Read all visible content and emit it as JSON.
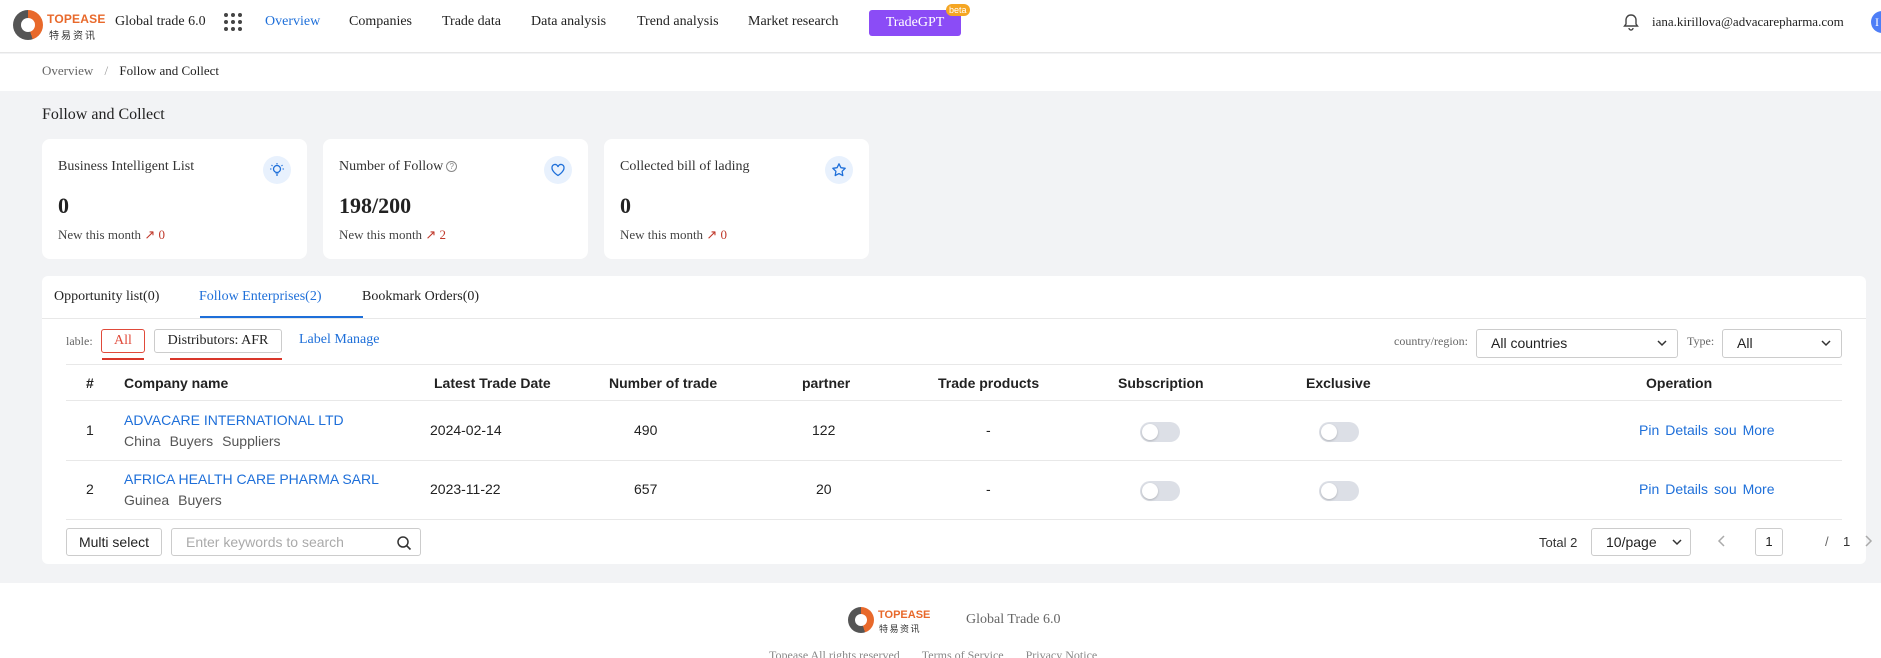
{
  "header": {
    "logo_text": "TOPEASE",
    "logo_subtext": "特易资讯",
    "product": "Global trade 6.0",
    "nav": [
      {
        "label": "Overview",
        "active": true
      },
      {
        "label": "Companies"
      },
      {
        "label": "Trade data"
      },
      {
        "label": "Data analysis"
      },
      {
        "label": "Trend analysis"
      },
      {
        "label": "Market research"
      }
    ],
    "tradegpt": "TradeGPT",
    "beta": "beta",
    "user_email": "iana.kirillova@advacarepharma.com",
    "avatar_initial": "I"
  },
  "breadcrumb": {
    "root": "Overview",
    "separator": "/",
    "current": "Follow and Collect"
  },
  "page_title": "Follow and Collect",
  "cards": [
    {
      "title": "Business Intelligent List",
      "value": "0",
      "new_label": "New this month",
      "new_value": "0",
      "icon": "bulb-icon"
    },
    {
      "title": "Number of Follow",
      "value": "198/200",
      "new_label": "New this month",
      "new_value": "2",
      "icon": "heart-icon",
      "help": "?"
    },
    {
      "title": "Collected bill of lading",
      "value": "0",
      "new_label": "New this month",
      "new_value": "0",
      "icon": "star-icon"
    }
  ],
  "tabs": [
    {
      "label": "Opportunity list(0)"
    },
    {
      "label": "Follow Enterprises(2)",
      "active": true
    },
    {
      "label": "Bookmark Orders(0)"
    }
  ],
  "filters": {
    "label_prefix": "lable:",
    "all_chip": "All",
    "label_chip": "Distributors: AFR",
    "label_manage": "Label Manage",
    "country_label": "country/region:",
    "country_value": "All countries",
    "type_label": "Type:",
    "type_value": "All"
  },
  "table": {
    "headers": [
      "#",
      "Company name",
      "Latest Trade Date",
      "Number of trade",
      "partner",
      "Trade products",
      "Subscription",
      "Exclusive",
      "Operation"
    ],
    "rows": [
      {
        "index": "1",
        "name": "ADVACARE INTERNATIONAL LTD",
        "tags": [
          "China",
          "Buyers",
          "Suppliers"
        ],
        "date": "2024-02-14",
        "trades": "490",
        "partner": "122",
        "products": "-",
        "ops": [
          "Pin",
          "Details",
          "sou",
          "More"
        ]
      },
      {
        "index": "2",
        "name": "AFRICA HEALTH CARE PHARMA SARL",
        "tags": [
          "Guinea",
          "Buyers"
        ],
        "date": "2023-11-22",
        "trades": "657",
        "partner": "20",
        "products": "-",
        "ops": [
          "Pin",
          "Details",
          "sou",
          "More"
        ]
      }
    ]
  },
  "bottom": {
    "multi_select": "Multi select",
    "search_placeholder": "Enter keywords to search",
    "total": "Total 2",
    "page_size": "10/page",
    "current_page": "1",
    "page_sep": "/",
    "total_pages": "1"
  },
  "footer": {
    "logo_text": "TOPEASE",
    "logo_subtext": "特易资讯",
    "product": "Global Trade 6.0",
    "links": [
      "Topease All rights reserved",
      "Terms of Service",
      "Privacy Notice"
    ]
  },
  "colors": {
    "accent": "#1e6fd9",
    "gpt": "#8b4cf6",
    "chip_active": "#e04a3a",
    "trend": "#c0392b"
  }
}
